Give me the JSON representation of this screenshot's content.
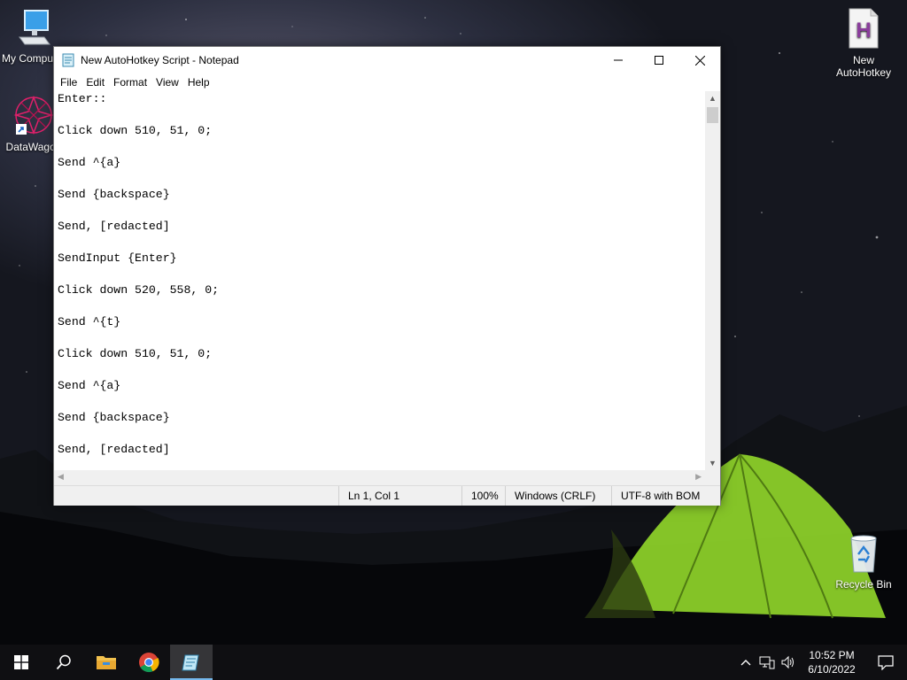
{
  "desktop": {
    "icons": [
      {
        "label": "My Computer"
      },
      {
        "label": "DataWagon"
      },
      {
        "label": "New AutoHotkey Script"
      },
      {
        "label": "Recycle Bin"
      }
    ]
  },
  "notepad": {
    "title": "New AutoHotkey Script - Notepad",
    "menu": [
      "File",
      "Edit",
      "Format",
      "View",
      "Help"
    ],
    "content": "Enter::\n\nClick down 510, 51, 0;\n\nSend ^{a}\n\nSend {backspace}\n\nSend, [redacted]\n\nSendInput {Enter}\n\nClick down 520, 558, 0;\n\nSend ^{t}\n\nClick down 510, 51, 0;\n\nSend ^{a}\n\nSend {backspace}\n\nSend, [redacted]",
    "status": {
      "position": "Ln 1, Col 1",
      "zoom": "100%",
      "line_ending": "Windows (CRLF)",
      "encoding": "UTF-8 with BOM"
    }
  },
  "taskbar": {
    "apps": [
      "start-icon",
      "search-icon",
      "file-explorer-icon",
      "chrome-icon",
      "notepad-icon"
    ],
    "active_app": "notepad",
    "clock": {
      "time": "10:52 PM",
      "date": "6/10/2022"
    }
  },
  "colors": {
    "accent": "#76b9ed",
    "tent": "#8fd42a"
  }
}
